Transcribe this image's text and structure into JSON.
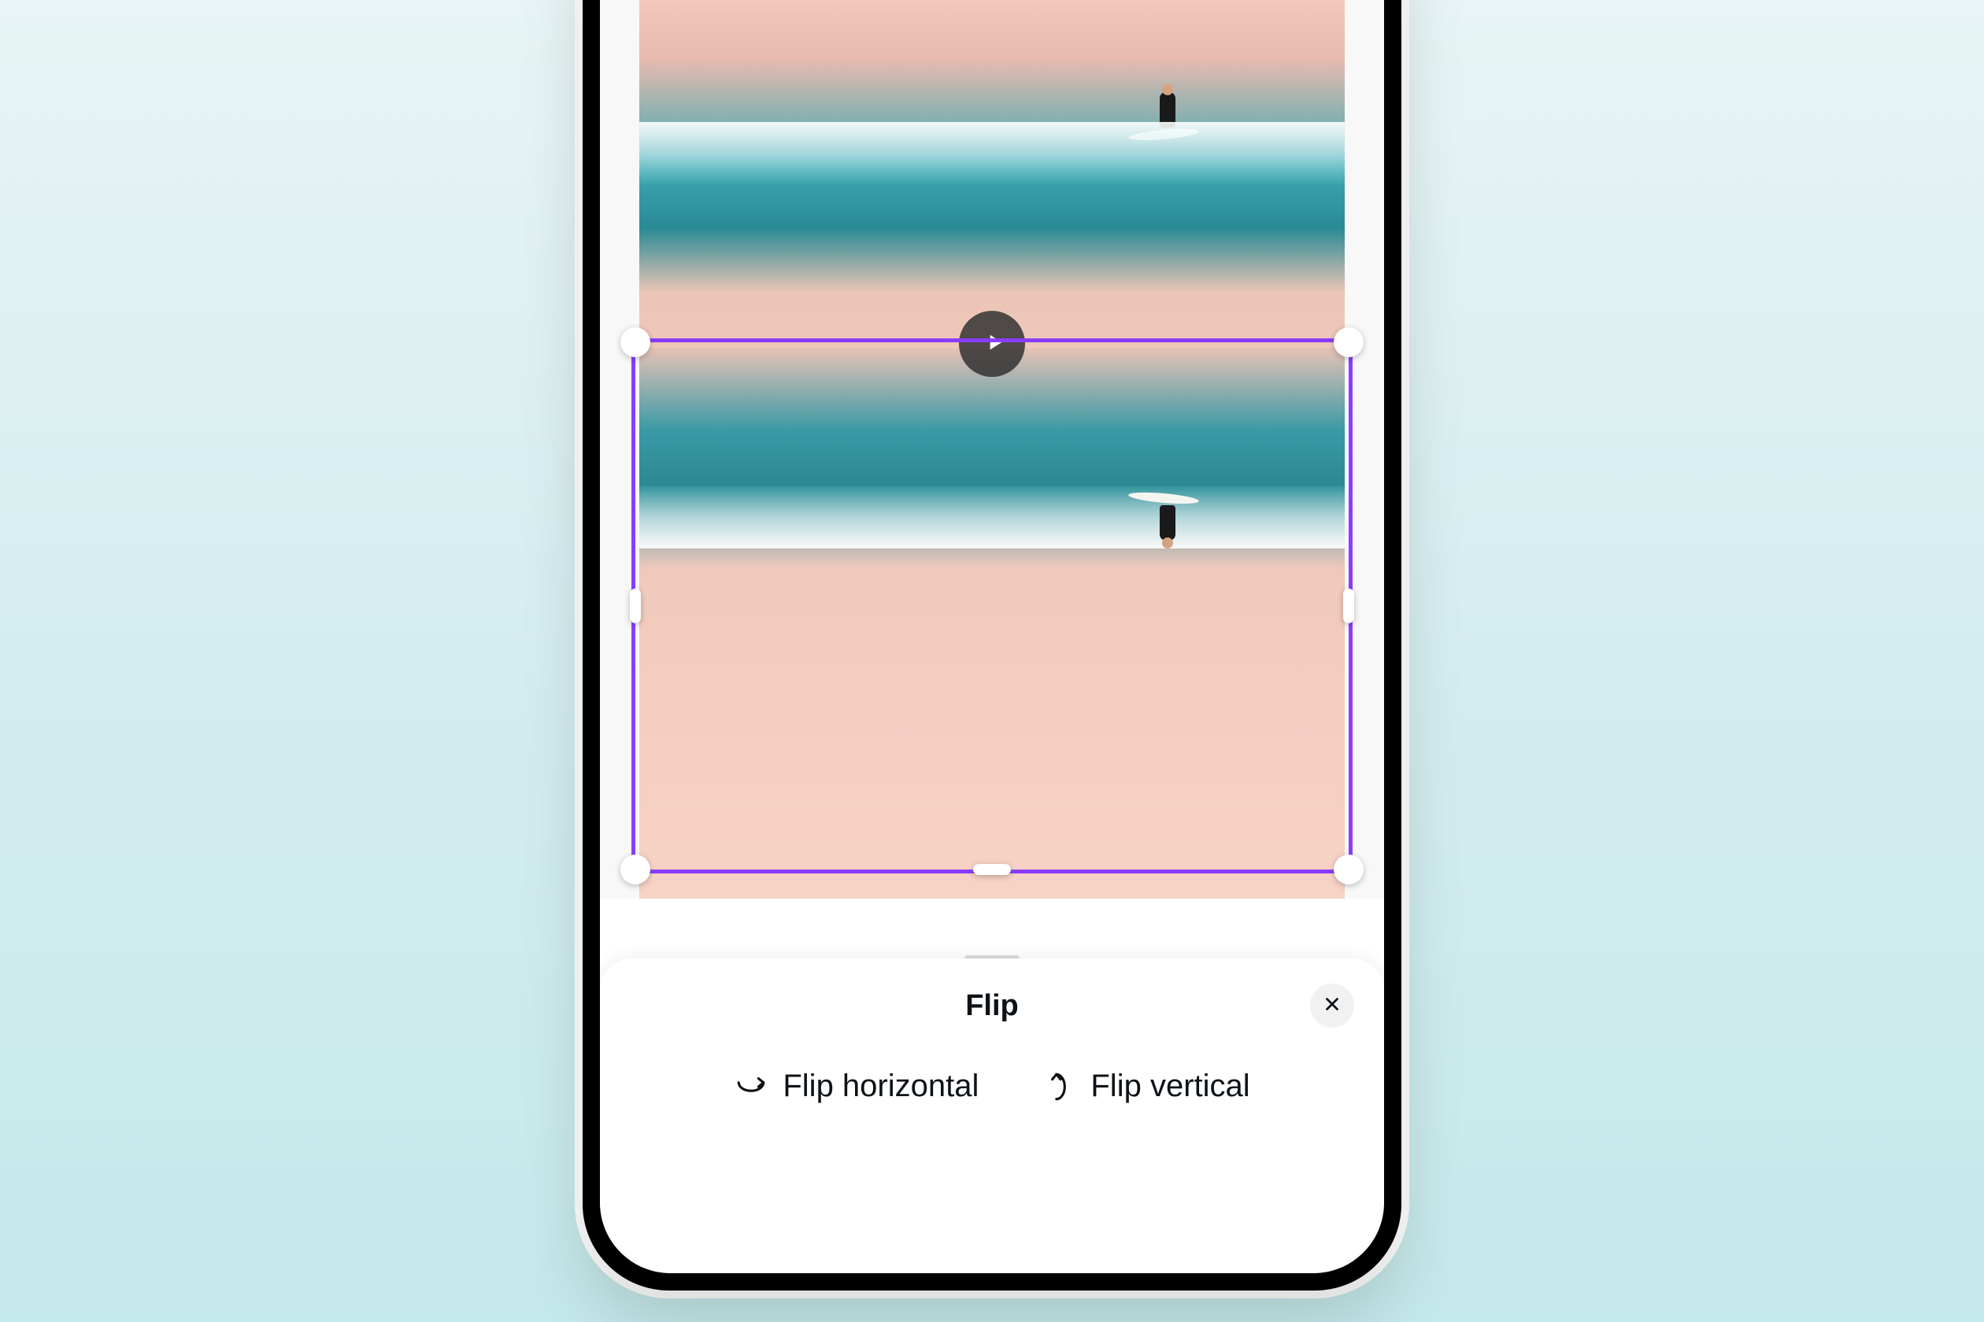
{
  "panel": {
    "title": "Flip",
    "options": {
      "horizontal_label": "Flip horizontal",
      "vertical_label": "Flip vertical"
    }
  },
  "colors": {
    "selection": "#8b3dff",
    "background_gradient_start": "#e8f4f5",
    "background_gradient_end": "#c5e8ea"
  },
  "icons": {
    "play": "play-icon",
    "close": "close-icon",
    "flip_horizontal": "flip-horizontal-icon",
    "flip_vertical": "flip-vertical-icon"
  }
}
